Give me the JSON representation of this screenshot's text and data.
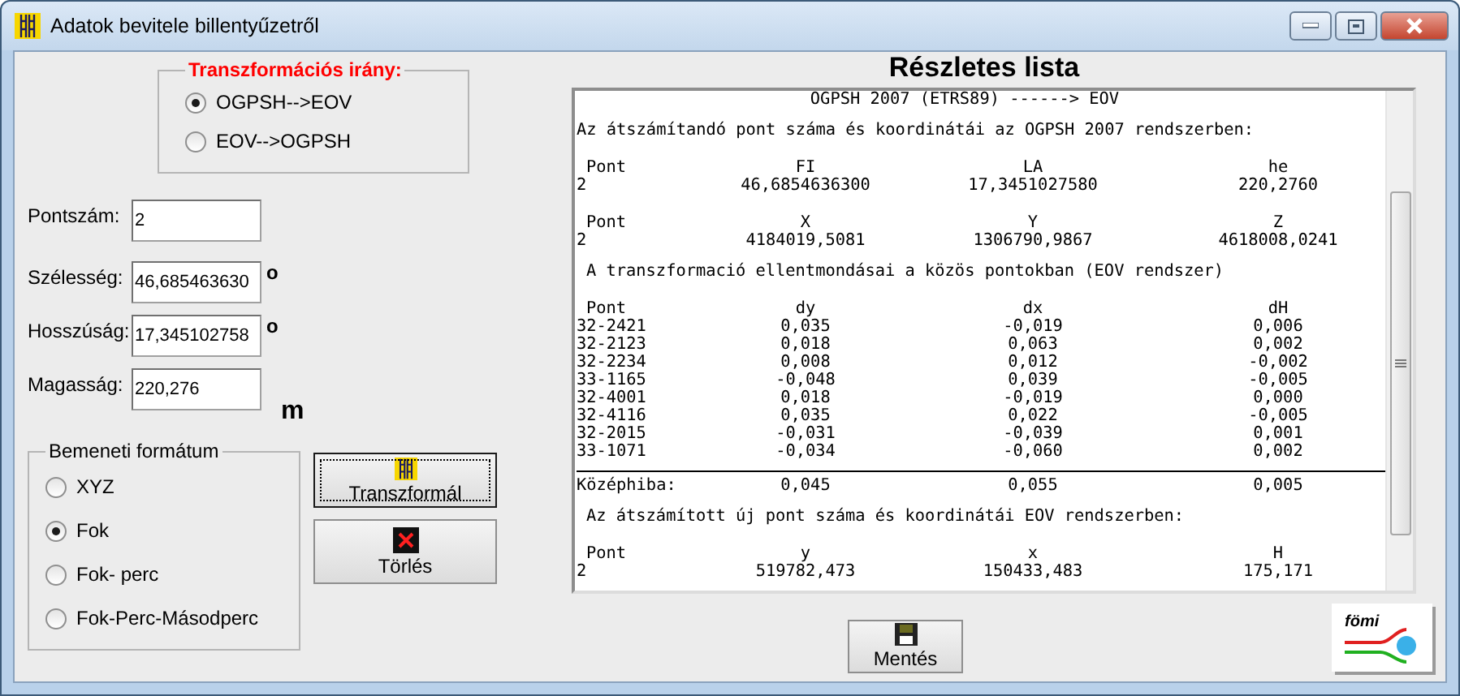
{
  "window": {
    "title": "Adatok bevitele billentyűzetről"
  },
  "direction_group": {
    "legend": "Transzformációs irány:",
    "options": [
      {
        "label": "OGPSH-->EOV",
        "selected": true
      },
      {
        "label": "EOV-->OGPSH",
        "selected": false
      }
    ]
  },
  "fields": [
    {
      "label": "Pontszám:",
      "value": "2"
    },
    {
      "label": "Szélesség:",
      "value": "46,685463630",
      "unit": "o"
    },
    {
      "label": "Hosszúság:",
      "value": "17,345102758",
      "unit": "o"
    },
    {
      "label": "Magasság:",
      "value": "220,276",
      "unit": "m"
    }
  ],
  "format_group": {
    "legend": "Bemeneti formátum",
    "options": [
      {
        "label": "XYZ",
        "selected": false
      },
      {
        "label": "Fok",
        "selected": true
      },
      {
        "label": "Fok- perc",
        "selected": false
      },
      {
        "label": "Fok-Perc-Másodperc",
        "selected": false
      }
    ]
  },
  "action_buttons": [
    {
      "label": "Transzformál",
      "kind": "transform",
      "focused": true
    },
    {
      "label": "Törlés",
      "kind": "delete",
      "focused": false
    }
  ],
  "list_title": "Részletes lista",
  "listing": [
    {
      "kind": "title",
      "text": "OGPSH 2007 (ETRS89) ------> EOV"
    },
    {
      "kind": "text",
      "text": "Az átszámítandó pont száma és koordinátái az OGPSH 2007 rendszerben:"
    },
    {
      "kind": "header",
      "cells": [
        "Pont",
        "FI",
        "LA",
        "he"
      ]
    },
    {
      "kind": "row",
      "cells": [
        "2",
        "46,6854636300",
        "17,3451027580",
        "220,2760"
      ]
    },
    {
      "kind": "header",
      "cells": [
        "Pont",
        "X",
        "Y",
        "Z"
      ]
    },
    {
      "kind": "row",
      "cells": [
        "2",
        "4184019,5081",
        "1306790,9867",
        "4618008,0241"
      ]
    },
    {
      "kind": "text",
      "text": "A transzformació ellentmondásai a közös pontokban (EOV rendszer)"
    },
    {
      "kind": "header",
      "cells": [
        "Pont",
        "dy",
        "dx",
        "dH"
      ]
    },
    {
      "kind": "row",
      "cells": [
        "32-2421",
        "0,035",
        "-0,019",
        "0,006"
      ]
    },
    {
      "kind": "row",
      "cells": [
        "32-2123",
        "0,018",
        "0,063",
        "0,002"
      ]
    },
    {
      "kind": "row",
      "cells": [
        "32-2234",
        "0,008",
        "0,012",
        "-0,002"
      ]
    },
    {
      "kind": "row",
      "cells": [
        "33-1165",
        "-0,048",
        "0,039",
        "-0,005"
      ]
    },
    {
      "kind": "row",
      "cells": [
        "32-4001",
        "0,018",
        "-0,019",
        "0,000"
      ]
    },
    {
      "kind": "row",
      "cells": [
        "32-4116",
        "0,035",
        "0,022",
        "-0,005"
      ]
    },
    {
      "kind": "row",
      "cells": [
        "32-2015",
        "-0,031",
        "-0,039",
        "0,001"
      ]
    },
    {
      "kind": "row",
      "cells": [
        "33-1071",
        "-0,034",
        "-0,060",
        "0,002"
      ]
    },
    {
      "kind": "rule"
    },
    {
      "kind": "row",
      "cells": [
        "Középhiba:",
        "0,045",
        "0,055",
        "0,005"
      ]
    },
    {
      "kind": "text",
      "text": "Az átszámított új pont száma és koordinátái EOV rendszerben:"
    },
    {
      "kind": "header",
      "cells": [
        "Pont",
        "y",
        "x",
        "H"
      ]
    },
    {
      "kind": "row",
      "cells": [
        "2",
        "519782,473",
        "150433,483",
        "175,171"
      ]
    }
  ],
  "save_button": {
    "label": "Mentés"
  },
  "logo": {
    "text": "fömi"
  }
}
